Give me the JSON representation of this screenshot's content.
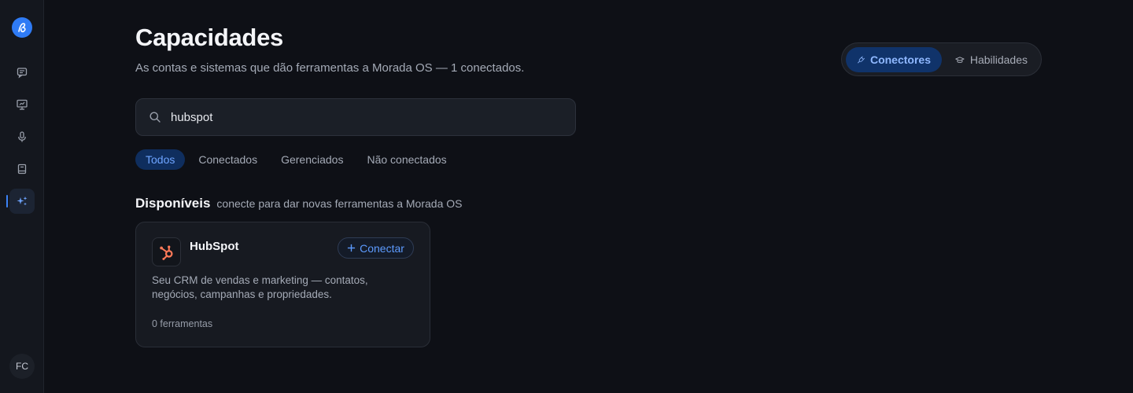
{
  "sidebar": {
    "logo_icon": "morada-logo-icon",
    "items": [
      {
        "icon": "chat-icon"
      },
      {
        "icon": "presentation-icon"
      },
      {
        "icon": "microphone-icon"
      },
      {
        "icon": "book-icon"
      },
      {
        "icon": "sparkles-icon",
        "active": true
      }
    ],
    "avatar_initials": "FC"
  },
  "header": {
    "title": "Capacidades",
    "subtitle": "As contas e sistemas que dão ferramentas a Morada OS — 1 conectados."
  },
  "view_toggle": {
    "connectors_label": "Conectores",
    "skills_label": "Habilidades",
    "selected": "Conectores"
  },
  "search": {
    "value": "hubspot",
    "placeholder": ""
  },
  "filters": [
    {
      "label": "Todos",
      "active": true
    },
    {
      "label": "Conectados"
    },
    {
      "label": "Gerenciados"
    },
    {
      "label": "Não conectados"
    }
  ],
  "section": {
    "title": "Disponíveis",
    "subtitle": "conecte para dar novas ferramentas a Morada OS"
  },
  "card": {
    "name": "HubSpot",
    "connect_label": "Conectar",
    "description": "Seu CRM de vendas e marketing — contatos, negócios, campanhas e propriedades.",
    "tools": "0 ferramentas"
  },
  "colors": {
    "accent": "#3b82f6",
    "hubspot": "#ff7a59",
    "background": "#0e1016"
  }
}
